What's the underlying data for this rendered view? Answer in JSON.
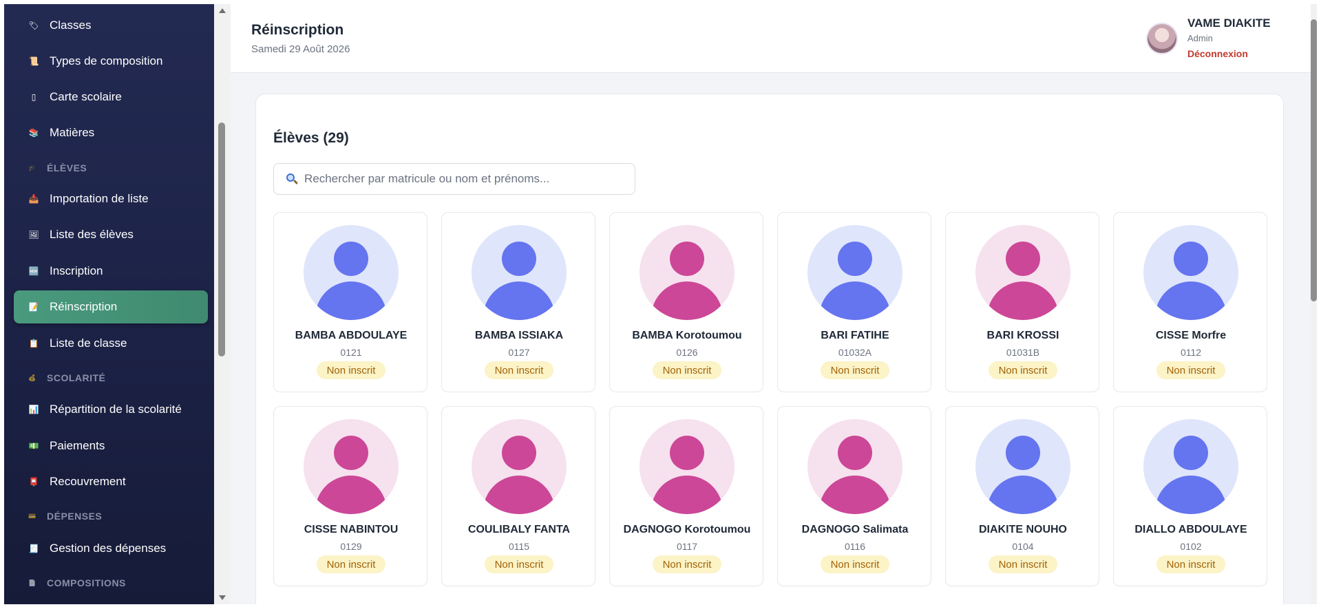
{
  "sidebar": {
    "items": [
      {
        "label": "Classes",
        "icon": "tag-icon",
        "glyph": "🏷"
      },
      {
        "label": "Types de composition",
        "icon": "scroll-icon",
        "glyph": "📜"
      },
      {
        "label": "Carte scolaire",
        "icon": "card-icon",
        "glyph": "▯"
      },
      {
        "label": "Matières",
        "icon": "books-icon",
        "glyph": "📚"
      },
      {
        "label": "Importation de liste",
        "icon": "inbox-icon",
        "glyph": "📥"
      },
      {
        "label": "Liste des élèves",
        "icon": "picture-icon",
        "glyph": "🖼"
      },
      {
        "label": "Inscription",
        "icon": "new-icon",
        "glyph": "🆕"
      },
      {
        "label": "Réinscription",
        "icon": "memo-icon",
        "glyph": "📝"
      },
      {
        "label": "Liste de classe",
        "icon": "clipboard-icon",
        "glyph": "📋"
      },
      {
        "label": "Répartition de la scolarité",
        "icon": "bar-chart-icon",
        "glyph": "📊"
      },
      {
        "label": "Paiements",
        "icon": "cash-icon",
        "glyph": "💵"
      },
      {
        "label": "Recouvrement",
        "icon": "mailbox-icon",
        "glyph": "📮"
      },
      {
        "label": "Gestion des dépenses",
        "icon": "receipt-icon",
        "glyph": "🧾"
      }
    ],
    "sections": [
      {
        "label": "ÉLÈVES",
        "icon": "graduation-icon",
        "glyph": "🎓"
      },
      {
        "label": "SCOLARITÉ",
        "icon": "money-bag-icon",
        "glyph": "💰"
      },
      {
        "label": "DÉPENSES",
        "icon": "credit-card-icon",
        "glyph": "💳"
      },
      {
        "label": "COMPOSITIONS",
        "icon": "document-icon",
        "glyph": "📄"
      }
    ],
    "active_label": "Réinscription",
    "active_color": "#4a9a7e"
  },
  "header": {
    "title": "Réinscription",
    "date": "Samedi 29 Août 2026",
    "user_name": "VAME DIAKITE",
    "user_role": "Admin",
    "logout_label": "Déconnexion"
  },
  "panel": {
    "title": "Élèves (29)",
    "search_placeholder": "Rechercher par matricule ou nom et prénoms...",
    "search_value": ""
  },
  "students": [
    {
      "name": "BAMBA ABDOULAYE",
      "matricule": "0121",
      "status": "Non inscrit",
      "gender": "m"
    },
    {
      "name": "BAMBA ISSIAKA",
      "matricule": "0127",
      "status": "Non inscrit",
      "gender": "m"
    },
    {
      "name": "BAMBA Korotoumou",
      "matricule": "0126",
      "status": "Non inscrit",
      "gender": "f"
    },
    {
      "name": "BARI FATIHE",
      "matricule": "01032A",
      "status": "Non inscrit",
      "gender": "m"
    },
    {
      "name": "BARI KROSSI",
      "matricule": "01031B",
      "status": "Non inscrit",
      "gender": "f"
    },
    {
      "name": "CISSE Morfre",
      "matricule": "0112",
      "status": "Non inscrit",
      "gender": "m"
    },
    {
      "name": "CISSE NABINTOU",
      "matricule": "0129",
      "status": "Non inscrit",
      "gender": "f"
    },
    {
      "name": "COULIBALY FANTA",
      "matricule": "0115",
      "status": "Non inscrit",
      "gender": "f"
    },
    {
      "name": "DAGNOGO Korotoumou",
      "matricule": "0117",
      "status": "Non inscrit",
      "gender": "f"
    },
    {
      "name": "DAGNOGO Salimata",
      "matricule": "0116",
      "status": "Non inscrit",
      "gender": "f"
    },
    {
      "name": "DIAKITE NOUHO",
      "matricule": "0104",
      "status": "Non inscrit",
      "gender": "m"
    },
    {
      "name": "DIALLO ABDOULAYE",
      "matricule": "0102",
      "status": "Non inscrit",
      "gender": "m"
    }
  ],
  "colors": {
    "sidebar_bg": "#1f2549",
    "male_avatar": "#6574ef",
    "female_avatar": "#cc4797",
    "badge_bg": "#fcf3c7",
    "badge_text": "#a16207",
    "logout": "#c0392b"
  }
}
